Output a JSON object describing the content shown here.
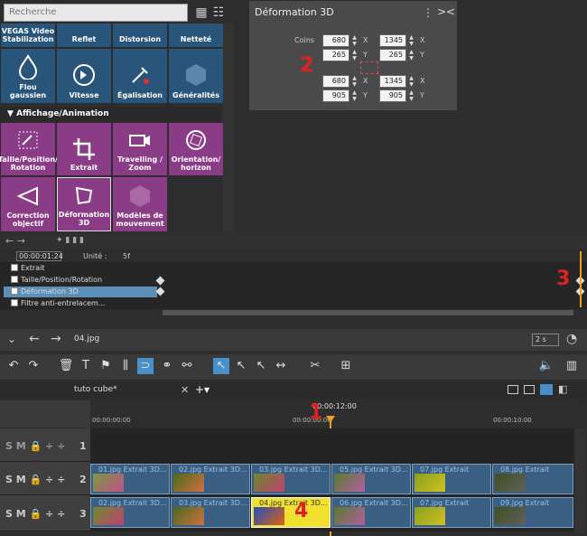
{
  "search": {
    "placeholder": "Recherche"
  },
  "tiles_top": [
    {
      "label": "VEGAS Video Stabilization"
    },
    {
      "label": "Reflet"
    },
    {
      "label": "Distorsion"
    },
    {
      "label": "Netteté"
    }
  ],
  "tiles_row2": [
    {
      "label": "Flou gaussien",
      "icon": "drop-icon"
    },
    {
      "label": "Vitesse",
      "icon": "speed-icon"
    },
    {
      "label": "Égalisation",
      "icon": "eyedropper-icon"
    },
    {
      "label": "Généralités",
      "icon": "hexagon-icon"
    }
  ],
  "category": {
    "label": "Affichage/Animation"
  },
  "tiles_row3": [
    {
      "label": "Taille/Position/ Rotation",
      "icon": "move-icon"
    },
    {
      "label": "Extrait",
      "icon": "crop-icon"
    },
    {
      "label": "Travelling / Zoom",
      "icon": "camera-icon"
    },
    {
      "label": "Orientation/ horizon",
      "icon": "rotate-icon"
    }
  ],
  "tiles_row4": [
    {
      "label": "Correction objectif",
      "icon": "lens-icon"
    },
    {
      "label": "Déformation 3D",
      "icon": "deform-icon"
    },
    {
      "label": "Modèles de mouvement",
      "icon": "hexagon-icon"
    }
  ],
  "panel": {
    "title": "Déformation 3D",
    "corners_label": "Coins",
    "x1": "680",
    "x2": "1345",
    "y1": "265",
    "y2": "265",
    "x3": "680",
    "x4": "1345",
    "y3": "905",
    "y4": "905",
    "xl": "X",
    "yl": "Y"
  },
  "keyframes": {
    "time": "00:00:01:24",
    "unit_label": "Unité :",
    "unit_value": "5f",
    "rows": [
      "Extrait",
      "Taille/Position/Rotation",
      "Déformation 3D",
      "Filtre anti-entrelacem..."
    ]
  },
  "nav": {
    "filename": "04.jpg",
    "duration": "2 s"
  },
  "tabs": {
    "project": "tuto cube*"
  },
  "timeline": {
    "center_time": "00:00:12:00",
    "t0": "00:00:00:00",
    "t1": "00:00:10:00",
    "tracks": [
      "1",
      "2",
      "3"
    ]
  },
  "clips2": [
    "01.jpg  Extrait  3D...",
    "02.jpg  Extrait  3D...",
    "03.jpg  Extrait  3D...",
    "05.jpg  Extrait  3D...",
    "07.jpg  Extrait",
    "08.jpg  Extrait"
  ],
  "clips3": [
    "02.jpg  Extrait  3D...",
    "03.jpg  Extrait  3D...",
    "04.jpg  Extrait  3D...",
    "06.jpg  Extrait  3D...",
    "07.jpg  Extrait",
    "09.jpg  Extrait"
  ],
  "markers": [
    "1",
    "2",
    "3",
    "4"
  ],
  "colors": {
    "accent": "#f0a020",
    "tile_blue": "#29557a",
    "tile_purple": "#8a3c86",
    "marker": "#e02020"
  }
}
